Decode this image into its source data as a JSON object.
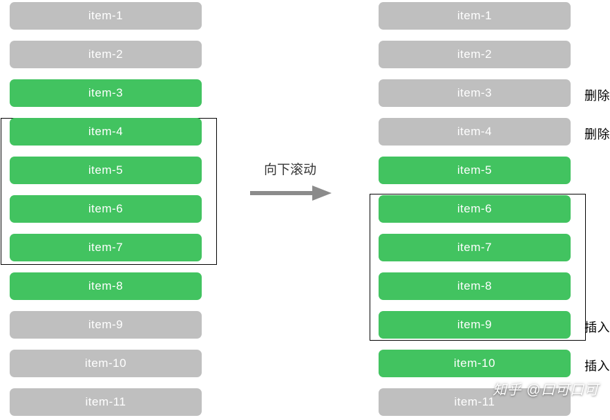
{
  "center_label": "向下滚动",
  "annotations": {
    "delete": "删除",
    "insert": "插入"
  },
  "left_list": [
    {
      "label": "item-1",
      "state": "gray"
    },
    {
      "label": "item-2",
      "state": "gray"
    },
    {
      "label": "item-3",
      "state": "green"
    },
    {
      "label": "item-4",
      "state": "green"
    },
    {
      "label": "item-5",
      "state": "green"
    },
    {
      "label": "item-6",
      "state": "green"
    },
    {
      "label": "item-7",
      "state": "green"
    },
    {
      "label": "item-8",
      "state": "green"
    },
    {
      "label": "item-9",
      "state": "gray"
    },
    {
      "label": "item-10",
      "state": "gray"
    },
    {
      "label": "item-11",
      "state": "gray"
    }
  ],
  "right_list": [
    {
      "label": "item-1",
      "state": "gray",
      "note": null
    },
    {
      "label": "item-2",
      "state": "gray",
      "note": null
    },
    {
      "label": "item-3",
      "state": "gray",
      "note": "delete"
    },
    {
      "label": "item-4",
      "state": "gray",
      "note": "delete"
    },
    {
      "label": "item-5",
      "state": "green",
      "note": null
    },
    {
      "label": "item-6",
      "state": "green",
      "note": null
    },
    {
      "label": "item-7",
      "state": "green",
      "note": null
    },
    {
      "label": "item-8",
      "state": "green",
      "note": null
    },
    {
      "label": "item-9",
      "state": "green",
      "note": "insert"
    },
    {
      "label": "item-10",
      "state": "green",
      "note": "insert"
    },
    {
      "label": "item-11",
      "state": "gray",
      "note": null
    }
  ],
  "left_viewport": {
    "start_index": 3,
    "end_index": 6
  },
  "right_viewport": {
    "start_index": 5,
    "end_index": 8
  },
  "watermark": "知乎 @口可口可"
}
